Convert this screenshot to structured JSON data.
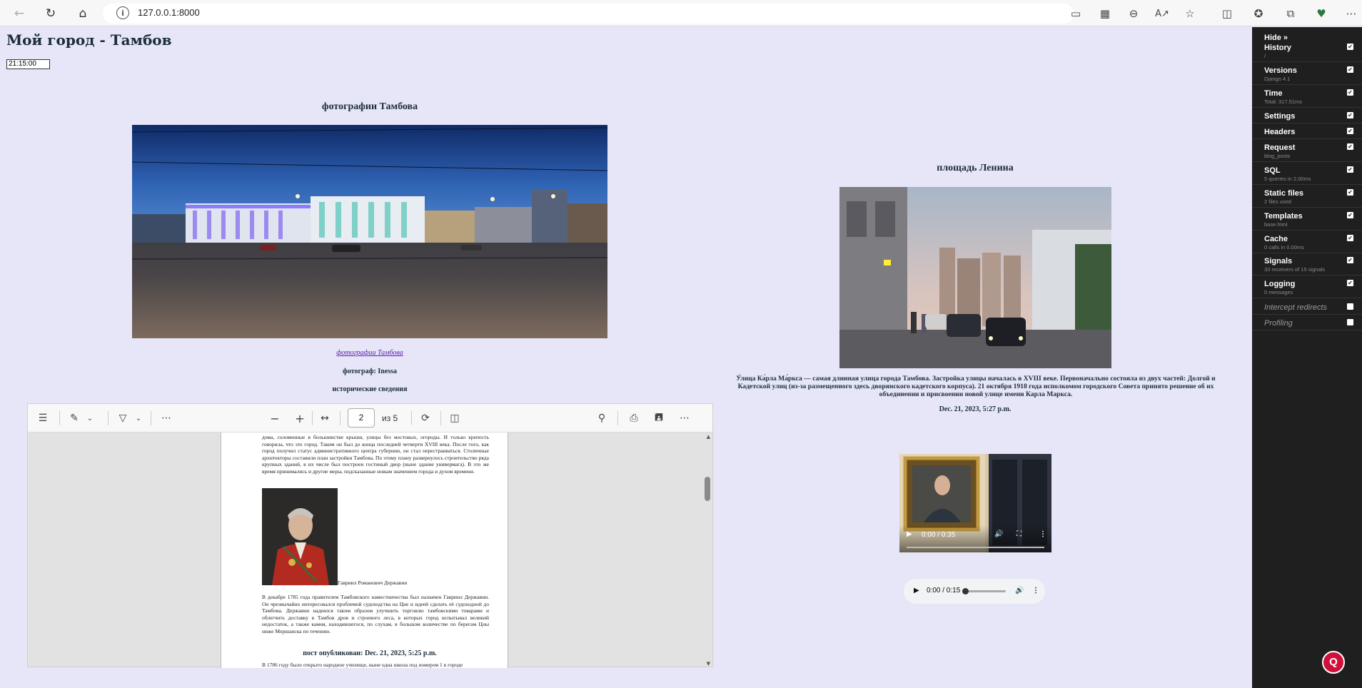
{
  "browser": {
    "url": "127.0.0.1:8000",
    "info_icon": "i",
    "nav_icons": [
      "back-icon",
      "reload-icon",
      "home-icon"
    ],
    "toolbar_icons": [
      "cast-icon",
      "apps-icon",
      "zoom-out-icon",
      "read-aloud-icon",
      "favorite-star-icon",
      "split-screen-icon",
      "favorites-icon",
      "collections-icon",
      "browser-essentials-icon",
      "more-icon"
    ]
  },
  "page": {
    "title": "Мой город - Тамбов",
    "time_value": "21:15:00",
    "left_post": {
      "heading": "фотографии Тамбова",
      "link_text": "фотографии Тамбова",
      "photographer": "фотограф: Inessa",
      "history_label": "исторические сведения",
      "published": "пост опубликован: Dec. 21, 2023, 5:25 p.m."
    },
    "right_post": {
      "heading": "площадь Ленина",
      "description": "У́лица Ка́рла Ма́ркса — самая длинная улица города Тамбова. Застройка улицы началась в XVIII веке. Первоначально состояла из двух частей: Долгой и Кадетской улиц (из-за размещенного здесь дворянского кадетского корпуса). 21 октября 1918 года исполкомом городского Совета принято решение об их объединении и присвоении новой улице имени Карла Маркса.",
      "date": "Dec. 21, 2023, 5:27 p.m."
    },
    "video": {
      "time": "0:00 / 0:35"
    },
    "audio": {
      "time": "0:00 / 0:15",
      "progress": 0
    }
  },
  "pdf": {
    "current_page": "2",
    "page_count_label": "из 5",
    "text_top": "дома, соломенные в большинстве крыши, улицы без мостовых, огороды. И только крепость говорила, что это город. Таким он был до конца последней четверти XVIII века. После того, как город получил статус административного центра губернии, он стал перестраиваться. Столичные архитекторы составили план застройки Тамбова. По этому плану развернулось строительство ряда крупных зданий, в их числе был построен гостиный двор (ныне здание универмага). В это же время принимались и другие меры, подсказанные новым значением города и духом времени.",
    "portrait_caption": "Гавриил Романович Державин",
    "text_bottom": "В декабре 1785 года правителем Тамбовского наместничества был назначен Гавриил Державин. Он чрезвычайно интересовался проблемой судоходства на Цне и идеей сделать её судоходной до Тамбова. Державин надеялся таким образом улучшить торговлю тамбовскими товарами и облегчить доставку в Тамбов дров и строевого леса, в которых город испытывал великий недостаток, а также камня, находившегося, по слухам, в большом количестве по берегам Цны ниже Моршанска по течению.",
    "text_cut": "В 1786 году было открыто народное училище, ныне одна школа под номером 1 в городе",
    "scroll_position": 0.18
  },
  "debug_toolbar": {
    "hide_label": "Hide »",
    "panels": [
      {
        "title": "History",
        "sub": "/",
        "checked": true
      },
      {
        "title": "Versions",
        "sub": "Django 4.1",
        "checked": true
      },
      {
        "title": "Time",
        "sub": "Total: 317.51ms",
        "checked": true
      },
      {
        "title": "Settings",
        "sub": "",
        "checked": true
      },
      {
        "title": "Headers",
        "sub": "",
        "checked": true
      },
      {
        "title": "Request",
        "sub": "blog_posts",
        "checked": true
      },
      {
        "title": "SQL",
        "sub": "5 queries in 2.00ms",
        "checked": true
      },
      {
        "title": "Static files",
        "sub": "2 files used",
        "checked": true
      },
      {
        "title": "Templates",
        "sub": "base.html",
        "checked": true
      },
      {
        "title": "Cache",
        "sub": "0 calls in 0.00ms",
        "checked": true
      },
      {
        "title": "Signals",
        "sub": "33 receivers of 15 signals",
        "checked": true
      },
      {
        "title": "Logging",
        "sub": "0 messages",
        "checked": true
      },
      {
        "title": "Intercept redirects",
        "sub": "",
        "checked": false
      },
      {
        "title": "Profiling",
        "sub": "",
        "checked": false
      }
    ]
  },
  "help_bubble": "Q"
}
